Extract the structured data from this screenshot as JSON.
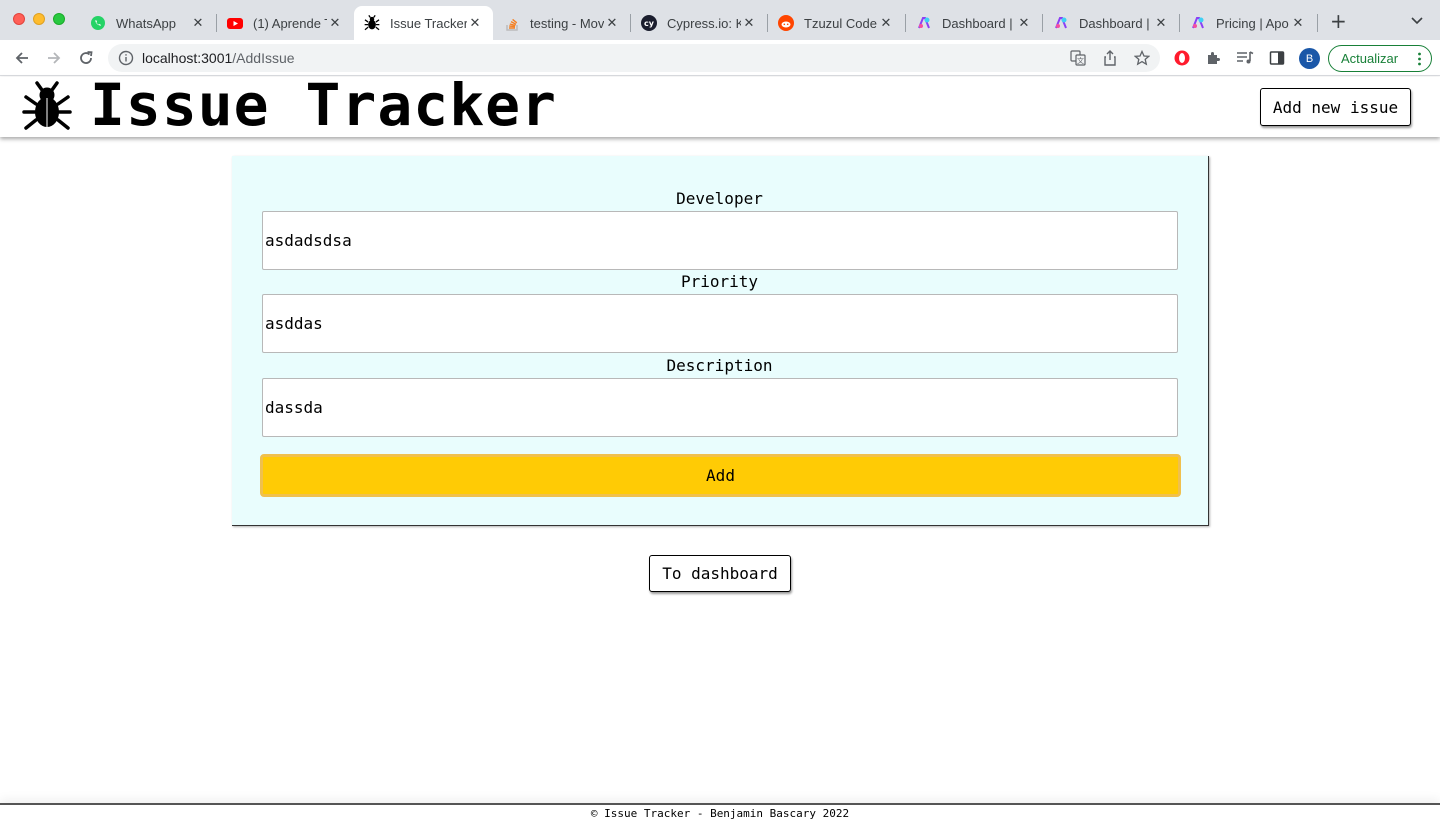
{
  "browser": {
    "tabs": [
      {
        "title": "WhatsApp",
        "icon": "whatsapp-icon",
        "active": false
      },
      {
        "title": "(1) Aprende T",
        "icon": "youtube-icon",
        "active": false
      },
      {
        "title": "Issue Tracker",
        "icon": "bug-icon",
        "active": true
      },
      {
        "title": "testing - Mov",
        "icon": "stackoverflow-icon",
        "active": false
      },
      {
        "title": "Cypress.io: K",
        "icon": "cypress-icon",
        "active": false
      },
      {
        "title": "Tzuzul Code",
        "icon": "reddit-icon",
        "active": false
      },
      {
        "title": "Dashboard |",
        "icon": "apollo-icon",
        "active": false
      },
      {
        "title": "Dashboard |",
        "icon": "apollo-icon",
        "active": false
      },
      {
        "title": "Pricing | Apo",
        "icon": "apollo-icon",
        "active": false
      }
    ],
    "url_host": "localhost:3001",
    "url_path": "/AddIssue",
    "profile_initial": "B",
    "update_label": "Actualizar"
  },
  "header": {
    "title": "Issue Tracker",
    "add_new_issue_label": "Add new issue"
  },
  "form": {
    "developer_label": "Developer",
    "developer_value": "asdadsdsa",
    "priority_label": "Priority",
    "priority_value": "asddas",
    "description_label": "Description",
    "description_value": "dassda",
    "add_label": "Add"
  },
  "dashboard_button_label": "To dashboard",
  "footer": {
    "text": "© Issue Tracker - Benjamin Bascary 2022"
  },
  "colors": {
    "add_button": "#ffcb05",
    "form_background": "#e9fdfd",
    "update_button": "#188038"
  }
}
